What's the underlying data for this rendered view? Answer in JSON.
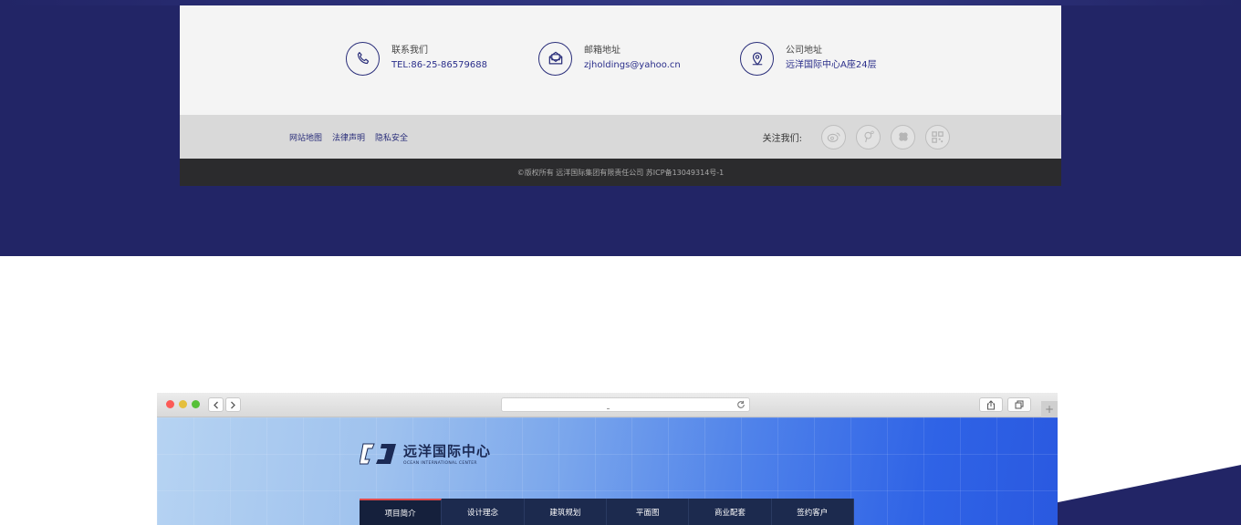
{
  "footer": {
    "contacts": [
      {
        "icon": "phone-icon",
        "label": "联系我们",
        "value": "TEL:86-25-86579688"
      },
      {
        "icon": "mail-icon",
        "label": "邮箱地址",
        "value": "zjholdings@yahoo.cn"
      },
      {
        "icon": "location-pin-icon",
        "label": "公司地址",
        "value": "远洋国际中心A座24层"
      }
    ],
    "links": [
      "网站地图",
      "法律声明",
      "隐私安全"
    ],
    "follow_label": "关注我们:",
    "social_icons": [
      "weibo-icon",
      "pinterest-icon",
      "clover-icon",
      "qrcode-icon"
    ],
    "copyright": "©版权所有 远洋国际集团有限责任公司 苏ICP备13049314号-1"
  },
  "browser": {
    "new_tab_label": "+",
    "site": {
      "logo_cn": "远洋国际中心",
      "logo_en": "OCEAN INTERNATIONAL CENTER",
      "nav": [
        "项目简介",
        "设计理念",
        "建筑规划",
        "平面图",
        "商业配套",
        "签约客户"
      ],
      "active_nav": "项目简介"
    }
  },
  "colors": {
    "navy": "#222566",
    "accent_blue": "#2a2e8a",
    "nav_bg": "#1c2a4e",
    "nav_active_border": "#e04a4a"
  }
}
